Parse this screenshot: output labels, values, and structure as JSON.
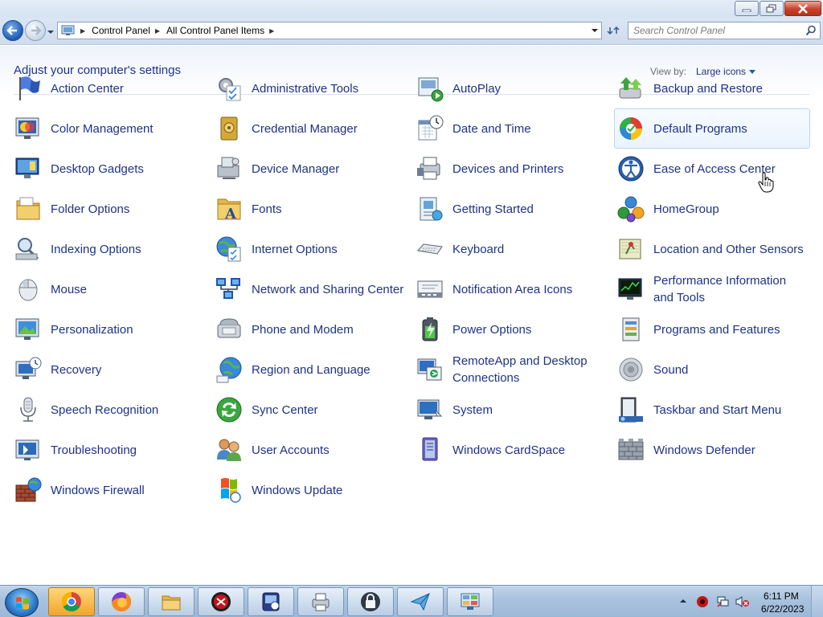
{
  "window": {
    "minimize_icon": "minimize-icon",
    "maximize_icon": "restore-icon",
    "close_icon": "close-icon"
  },
  "address_bar": {
    "breadcrumbs": [
      "Control Panel",
      "All Control Panel Items"
    ],
    "search_placeholder": "Search Control Panel"
  },
  "header": {
    "title": "Adjust your computer's settings",
    "view_by_label": "View by:",
    "view_by_value": "Large icons"
  },
  "items": [
    {
      "label": "Action Center",
      "icon": "flag-icon"
    },
    {
      "label": "Administrative Tools",
      "icon": "admin-tools-icon"
    },
    {
      "label": "AutoPlay",
      "icon": "autoplay-icon"
    },
    {
      "label": "Backup and Restore",
      "icon": "backup-icon"
    },
    {
      "label": "Color Management",
      "icon": "color-icon"
    },
    {
      "label": "Credential Manager",
      "icon": "vault-icon"
    },
    {
      "label": "Date and Time",
      "icon": "calendar-icon"
    },
    {
      "label": "Default Programs",
      "icon": "default-programs-icon"
    },
    {
      "label": "Desktop Gadgets",
      "icon": "gadgets-icon"
    },
    {
      "label": "Device Manager",
      "icon": "device-manager-icon"
    },
    {
      "label": "Devices and Printers",
      "icon": "printer-icon"
    },
    {
      "label": "Ease of Access Center",
      "icon": "accessibility-icon"
    },
    {
      "label": "Folder Options",
      "icon": "folder-icon"
    },
    {
      "label": "Fonts",
      "icon": "fonts-icon"
    },
    {
      "label": "Getting Started",
      "icon": "getting-started-icon"
    },
    {
      "label": "HomeGroup",
      "icon": "homegroup-icon"
    },
    {
      "label": "Indexing Options",
      "icon": "indexing-icon"
    },
    {
      "label": "Internet Options",
      "icon": "globe-icon"
    },
    {
      "label": "Keyboard",
      "icon": "keyboard-icon"
    },
    {
      "label": "Location and Other Sensors",
      "icon": "sensors-icon"
    },
    {
      "label": "Mouse",
      "icon": "mouse-icon"
    },
    {
      "label": "Network and Sharing Center",
      "icon": "network-icon"
    },
    {
      "label": "Notification Area Icons",
      "icon": "notification-icon"
    },
    {
      "label": "Performance Information and Tools",
      "icon": "performance-icon"
    },
    {
      "label": "Personalization",
      "icon": "personalization-icon"
    },
    {
      "label": "Phone and Modem",
      "icon": "phone-icon"
    },
    {
      "label": "Power Options",
      "icon": "battery-icon"
    },
    {
      "label": "Programs and Features",
      "icon": "programs-icon"
    },
    {
      "label": "Recovery",
      "icon": "recovery-icon"
    },
    {
      "label": "Region and Language",
      "icon": "region-icon"
    },
    {
      "label": "RemoteApp and Desktop Connections",
      "icon": "remoteapp-icon"
    },
    {
      "label": "Sound",
      "icon": "speaker-icon"
    },
    {
      "label": "Speech Recognition",
      "icon": "microphone-icon"
    },
    {
      "label": "Sync Center",
      "icon": "sync-icon"
    },
    {
      "label": "System",
      "icon": "system-icon"
    },
    {
      "label": "Taskbar and Start Menu",
      "icon": "taskbar-icon"
    },
    {
      "label": "Troubleshooting",
      "icon": "troubleshooting-icon"
    },
    {
      "label": "User Accounts",
      "icon": "users-icon"
    },
    {
      "label": "Windows CardSpace",
      "icon": "cardspace-icon"
    },
    {
      "label": "Windows Defender",
      "icon": "defender-icon"
    },
    {
      "label": "Windows Firewall",
      "icon": "firewall-icon"
    },
    {
      "label": "Windows Update",
      "icon": "update-icon"
    }
  ],
  "hovered_item": "Default Programs",
  "taskbar": {
    "apps": [
      "chrome-icon",
      "firefox-icon",
      "file-explorer-icon",
      "security-app-icon",
      "remote-app-icon",
      "printer-app-icon",
      "vpn-lock-icon",
      "mail-app-icon",
      "control-panel-icon"
    ],
    "active_app": "control-panel-icon",
    "clock_time": "6:11 PM",
    "clock_date": "6/22/2023"
  }
}
